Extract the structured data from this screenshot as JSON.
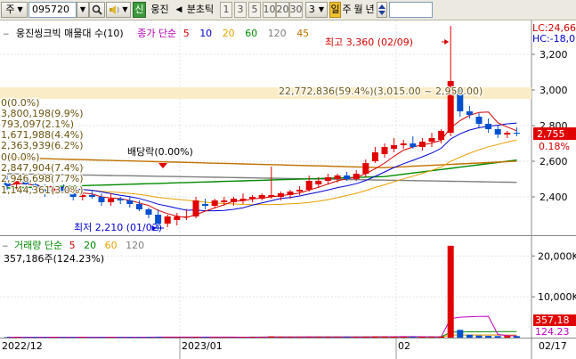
{
  "toolbar": {
    "market_label": "주",
    "stock_code": "095720",
    "stock_name": "웅진",
    "credit_badge": "신",
    "period_prev": "◀",
    "period_label": "분초틱",
    "periods": [
      "1",
      "3",
      "5",
      "10",
      "20",
      "30"
    ],
    "period_selected": "3",
    "timeframes": [
      "일",
      "주",
      "월",
      "년"
    ],
    "timeframe_selected": "일"
  },
  "price_pane": {
    "title": "웅진씽크빅 매물대 수(10)",
    "ma_prefix": "종가 단순",
    "ma_periods": [
      {
        "label": "5",
        "color": "#d40000"
      },
      {
        "label": "10",
        "color": "#0000d4"
      },
      {
        "label": "20",
        "color": "#e8a000"
      },
      {
        "label": "60",
        "color": "#008a00"
      },
      {
        "label": "120",
        "color": "#7f7f7f"
      },
      {
        "label": "45",
        "color": "#c07000"
      }
    ],
    "lc_label": "LC:24,66",
    "hc_label": "HC:-18,0",
    "high_label": "최고 3,360 (02/09)",
    "low_label": "최저 2,210 (01/02)",
    "dividend_label": "배당락(0.00%)",
    "current_price": "2,755",
    "current_change": "0.18%",
    "volume_profile_top": "22,772,836(59.4%)(3,015.00 ~ 2,950.00)",
    "volume_profile": [
      "0(0.0%)",
      "3,800,198(9.9%)",
      "793,097(2.1%)",
      "1,671,988(4.4%)",
      "2,363,939(6.2%)",
      "0(0.0%)",
      "2,847,904(7.4%)",
      "2,946,698(7.7%)",
      "1,144,361(3.0%)"
    ]
  },
  "volume_pane": {
    "title": "거래량 단순",
    "ma_periods": [
      {
        "label": "5",
        "color": "#d40000"
      },
      {
        "label": "20",
        "color": "#008a00"
      },
      {
        "label": "60",
        "color": "#e8a000"
      },
      {
        "label": "120",
        "color": "#7f7f7f"
      }
    ],
    "current_volume": "357,186주(124.23%)",
    "volume_badge": "357,18",
    "volume_pct_badge": "124.23"
  },
  "date_axis": {
    "labels": [
      "2022/12",
      "2023/01",
      "02",
      "02/17"
    ]
  },
  "chart_data": [
    {
      "type": "candlestick",
      "title": "웅진씽크빅 매물대 수(10)",
      "y_ticks": [
        2400,
        2600,
        2800,
        3000,
        3200
      ],
      "ylim": [
        2200,
        3330
      ],
      "high": {
        "value": 3360,
        "date": "02/09"
      },
      "low": {
        "value": 2210,
        "date": "01/02"
      },
      "candles": [
        {
          "o": 2480,
          "h": 2520,
          "l": 2440,
          "c": 2460
        },
        {
          "o": 2470,
          "h": 2510,
          "l": 2440,
          "c": 2490
        },
        {
          "o": 2490,
          "h": 2520,
          "l": 2460,
          "c": 2470
        },
        {
          "o": 2470,
          "h": 2490,
          "l": 2430,
          "c": 2440
        },
        {
          "o": 2440,
          "h": 2470,
          "l": 2400,
          "c": 2430
        },
        {
          "o": 2430,
          "h": 2460,
          "l": 2410,
          "c": 2450
        },
        {
          "o": 2450,
          "h": 2470,
          "l": 2420,
          "c": 2420
        },
        {
          "o": 2420,
          "h": 2440,
          "l": 2380,
          "c": 2400
        },
        {
          "o": 2400,
          "h": 2430,
          "l": 2380,
          "c": 2410
        },
        {
          "o": 2410,
          "h": 2440,
          "l": 2390,
          "c": 2400
        },
        {
          "o": 2400,
          "h": 2420,
          "l": 2350,
          "c": 2370
        },
        {
          "o": 2370,
          "h": 2420,
          "l": 2350,
          "c": 2390
        },
        {
          "o": 2390,
          "h": 2400,
          "l": 2360,
          "c": 2380
        },
        {
          "o": 2380,
          "h": 2400,
          "l": 2340,
          "c": 2360
        },
        {
          "o": 2360,
          "h": 2380,
          "l": 2320,
          "c": 2330
        },
        {
          "o": 2330,
          "h": 2340,
          "l": 2280,
          "c": 2300
        },
        {
          "o": 2300,
          "h": 2330,
          "l": 2210,
          "c": 2250
        },
        {
          "o": 2250,
          "h": 2300,
          "l": 2230,
          "c": 2290
        },
        {
          "o": 2270,
          "h": 2310,
          "l": 2240,
          "c": 2290
        },
        {
          "o": 2290,
          "h": 2330,
          "l": 2270,
          "c": 2290
        },
        {
          "o": 2290,
          "h": 2400,
          "l": 2280,
          "c": 2380
        },
        {
          "o": 2360,
          "h": 2390,
          "l": 2330,
          "c": 2350
        },
        {
          "o": 2350,
          "h": 2390,
          "l": 2340,
          "c": 2380
        },
        {
          "o": 2370,
          "h": 2400,
          "l": 2350,
          "c": 2380
        },
        {
          "o": 2370,
          "h": 2400,
          "l": 2350,
          "c": 2390
        },
        {
          "o": 2380,
          "h": 2420,
          "l": 2360,
          "c": 2390
        },
        {
          "o": 2390,
          "h": 2410,
          "l": 2370,
          "c": 2400
        },
        {
          "o": 2390,
          "h": 2420,
          "l": 2380,
          "c": 2410
        },
        {
          "o": 2400,
          "h": 2570,
          "l": 2390,
          "c": 2410
        },
        {
          "o": 2400,
          "h": 2430,
          "l": 2380,
          "c": 2420
        },
        {
          "o": 2410,
          "h": 2440,
          "l": 2390,
          "c": 2430
        },
        {
          "o": 2430,
          "h": 2460,
          "l": 2410,
          "c": 2440
        },
        {
          "o": 2440,
          "h": 2520,
          "l": 2430,
          "c": 2490
        },
        {
          "o": 2470,
          "h": 2510,
          "l": 2450,
          "c": 2490
        },
        {
          "o": 2490,
          "h": 2530,
          "l": 2470,
          "c": 2510
        },
        {
          "o": 2500,
          "h": 2530,
          "l": 2480,
          "c": 2520
        },
        {
          "o": 2520,
          "h": 2540,
          "l": 2490,
          "c": 2500
        },
        {
          "o": 2500,
          "h": 2550,
          "l": 2490,
          "c": 2530
        },
        {
          "o": 2530,
          "h": 2610,
          "l": 2510,
          "c": 2590
        },
        {
          "o": 2600,
          "h": 2680,
          "l": 2590,
          "c": 2650
        },
        {
          "o": 2640,
          "h": 2700,
          "l": 2620,
          "c": 2680
        },
        {
          "o": 2670,
          "h": 2730,
          "l": 2650,
          "c": 2690
        },
        {
          "o": 2690,
          "h": 2720,
          "l": 2670,
          "c": 2700
        },
        {
          "o": 2700,
          "h": 2740,
          "l": 2670,
          "c": 2680
        },
        {
          "o": 2680,
          "h": 2730,
          "l": 2660,
          "c": 2710
        },
        {
          "o": 2710,
          "h": 2760,
          "l": 2680,
          "c": 2730
        },
        {
          "o": 2720,
          "h": 2780,
          "l": 2700,
          "c": 2770
        },
        {
          "o": 2760,
          "h": 3360,
          "l": 2740,
          "c": 3050
        },
        {
          "o": 2980,
          "h": 3010,
          "l": 2850,
          "c": 2880
        },
        {
          "o": 2880,
          "h": 2910,
          "l": 2840,
          "c": 2860
        },
        {
          "o": 2850,
          "h": 2870,
          "l": 2790,
          "c": 2810
        },
        {
          "o": 2810,
          "h": 2840,
          "l": 2760,
          "c": 2780
        },
        {
          "o": 2780,
          "h": 2800,
          "l": 2730,
          "c": 2750
        },
        {
          "o": 2750,
          "h": 2770,
          "l": 2730,
          "c": 2760
        },
        {
          "o": 2760,
          "h": 2790,
          "l": 2740,
          "c": 2755
        }
      ]
    },
    {
      "type": "bar",
      "title": "거래량",
      "y_ticks": [
        10000,
        20000
      ],
      "y_tick_labels": [
        "10,000K",
        "20,000K"
      ],
      "ylim": [
        0,
        24000
      ],
      "unit": "K",
      "values": [
        120,
        110,
        100,
        130,
        90,
        100,
        110,
        120,
        100,
        90,
        110,
        100,
        120,
        130,
        110,
        140,
        160,
        130,
        120,
        110,
        150,
        130,
        120,
        110,
        100,
        130,
        140,
        120,
        300,
        180,
        150,
        140,
        160,
        170,
        150,
        140,
        160,
        150,
        200,
        280,
        260,
        240,
        200,
        180,
        210,
        190,
        230,
        22500,
        1900,
        700,
        500,
        420,
        380,
        400,
        357
      ]
    }
  ]
}
